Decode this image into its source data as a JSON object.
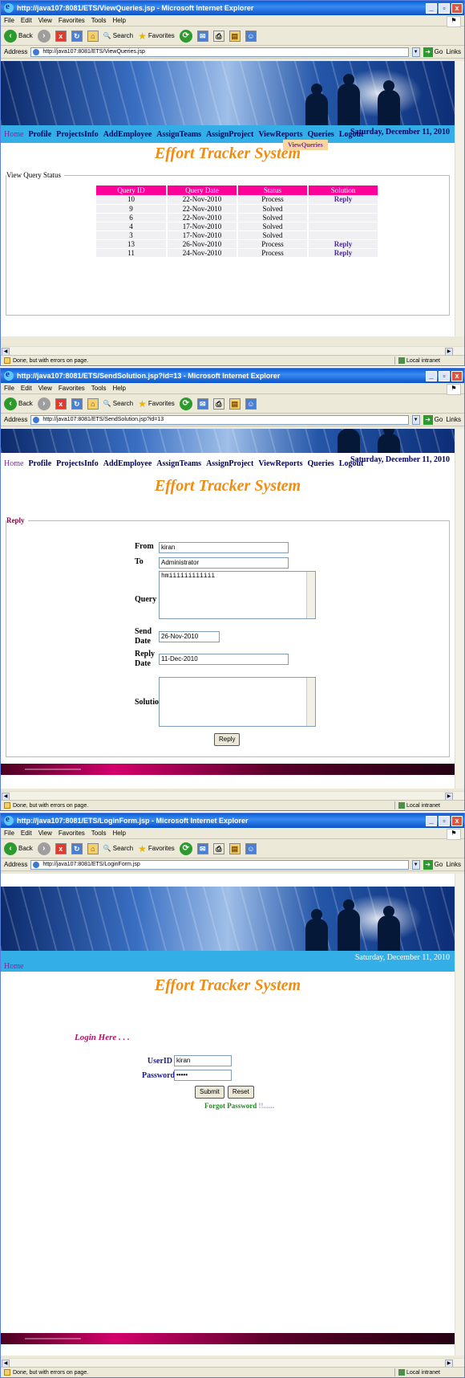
{
  "browser": {
    "menu": [
      "File",
      "Edit",
      "View",
      "Favorites",
      "Tools",
      "Help"
    ],
    "back_label": "Back",
    "search_label": "Search",
    "favorites_label": "Favorites",
    "address_label": "Address",
    "go_label": "Go",
    "links_label": "Links",
    "status_text": "Done, but with errors on page.",
    "zone_text": "Local intranet"
  },
  "app": {
    "title": "Effort Tracker System",
    "date": "Saturday, December 11, 2010",
    "nav": [
      "Home",
      "Profile",
      "ProjectsInfo",
      "AddEmployee",
      "AssignTeams",
      "AssignProject",
      "ViewReports",
      "Queries",
      "Logout"
    ]
  },
  "screens": {
    "view_queries": {
      "window_title": "http://java107:8081/ETS/ViewQueries.jsp - Microsoft Internet Explorer",
      "url": "http://java107:8081/ETS/ViewQueries.jsp",
      "dropdown_item": "ViewQueries",
      "panel_legend": "View Query Status",
      "columns": [
        "Query ID",
        "Query Date",
        "Status",
        "Solution"
      ],
      "rows": [
        {
          "id": "10",
          "date": "22-Nov-2010",
          "status": "Process",
          "solution": "Reply"
        },
        {
          "id": "9",
          "date": "22-Nov-2010",
          "status": "Solved",
          "solution": ""
        },
        {
          "id": "6",
          "date": "22-Nov-2010",
          "status": "Solved",
          "solution": ""
        },
        {
          "id": "4",
          "date": "17-Nov-2010",
          "status": "Solved",
          "solution": ""
        },
        {
          "id": "3",
          "date": "17-Nov-2010",
          "status": "Solved",
          "solution": ""
        },
        {
          "id": "13",
          "date": "26-Nov-2010",
          "status": "Process",
          "solution": "Reply"
        },
        {
          "id": "11",
          "date": "24-Nov-2010",
          "status": "Process",
          "solution": "Reply"
        }
      ]
    },
    "send_solution": {
      "window_title": "http://java107:8081/ETS/SendSolution.jsp?id=13 - Microsoft Internet Explorer",
      "url": "http://java107:8081/ETS/SendSolution.jsp?id=13",
      "panel_legend": "Reply",
      "labels": {
        "from": "From",
        "to": "To",
        "query": "Query",
        "send_date": "Send Date",
        "reply_date": "Reply Date",
        "solution": "Solution"
      },
      "values": {
        "from": "kiran",
        "to": "Administrator",
        "query": "hmiiiiiiiiiiii",
        "send_date": "26-Nov-2010",
        "reply_date": "11-Dec-2010",
        "solution": ""
      },
      "submit_label": "Reply"
    },
    "login": {
      "window_title": "http://java107:8081/ETS/LoginForm.jsp - Microsoft Internet Explorer",
      "url": "http://java107:8081/ETS/LoginForm.jsp",
      "nav_home": "Home",
      "heading": "Login Here . . .",
      "userid_label": "UserID",
      "userid_value": "kiran",
      "password_label": "Password",
      "password_value": "•••••",
      "submit_label": "Submit",
      "reset_label": "Reset",
      "forgot_label": "Forgot Password",
      "forgot_suffix": "!!......"
    }
  }
}
